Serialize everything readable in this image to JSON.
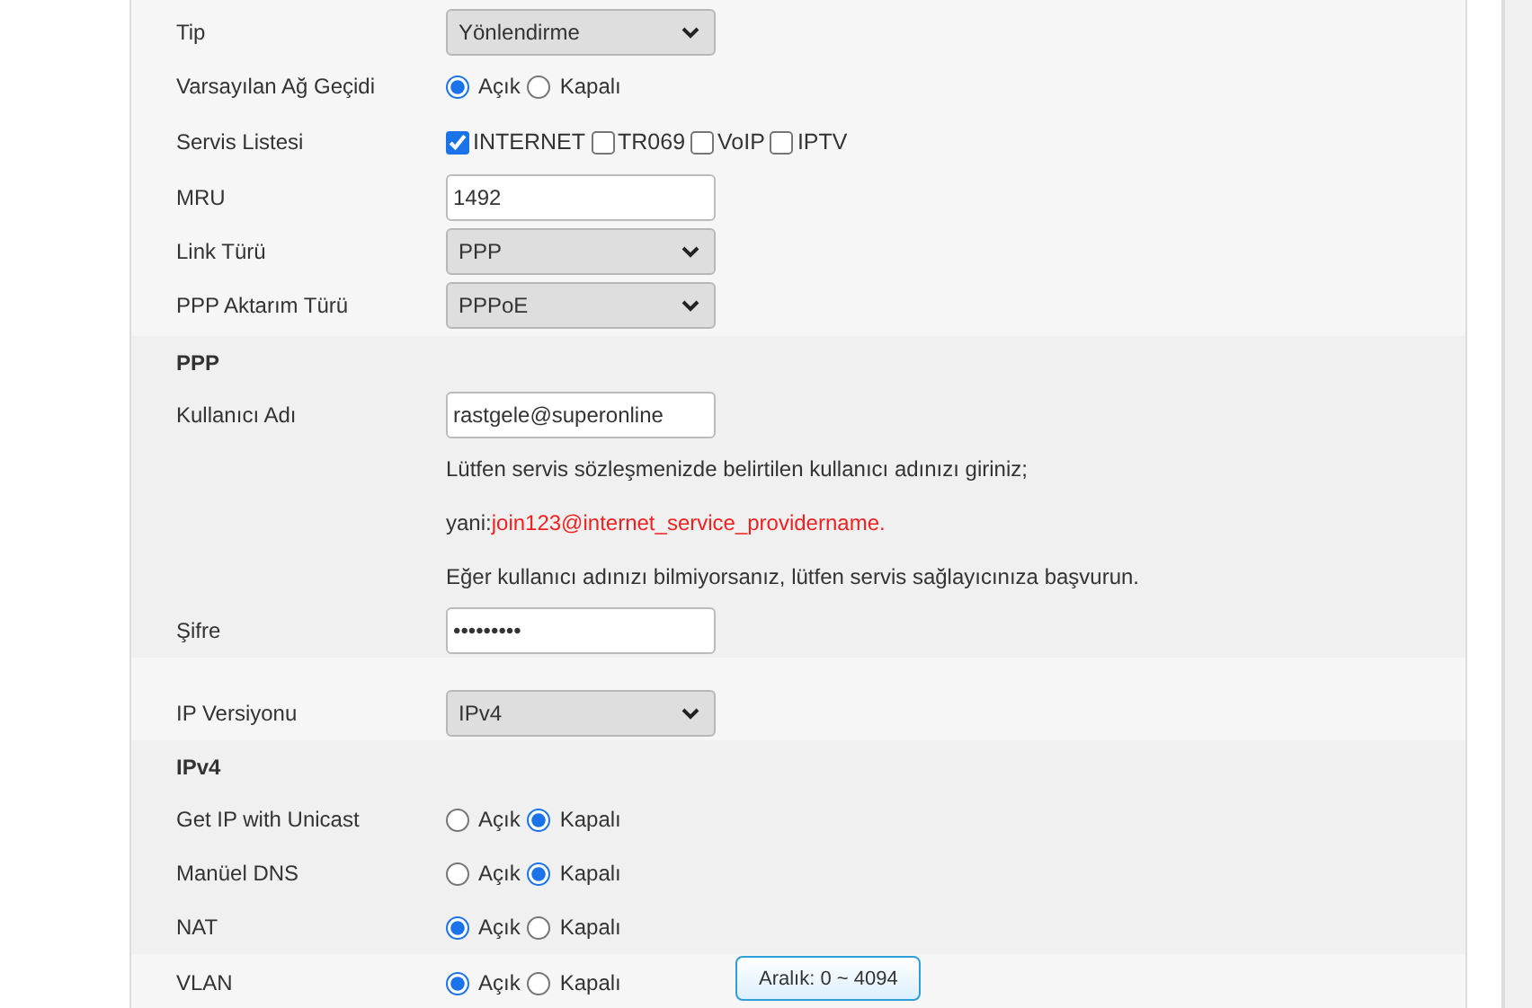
{
  "sections": [
    {
      "rows": [
        {
          "kind": "select",
          "label": "Tip",
          "value": "Yönlendirme"
        },
        {
          "kind": "radio",
          "label": "Varsayılan Ağ Geçidi",
          "options": [
            {
              "label": "Açık",
              "selected": true
            },
            {
              "label": "Kapalı",
              "selected": false
            }
          ]
        },
        {
          "kind": "checkboxes",
          "label": "Servis Listesi",
          "options": [
            {
              "label": "INTERNET",
              "checked": true
            },
            {
              "label": "TR069",
              "checked": false
            },
            {
              "label": "VoIP",
              "checked": false
            },
            {
              "label": "IPTV",
              "checked": false
            }
          ]
        },
        {
          "kind": "text",
          "label": "MRU",
          "value": "1492"
        },
        {
          "kind": "select",
          "label": "Link Türü",
          "value": "PPP"
        },
        {
          "kind": "select",
          "label": "PPP Aktarım Türü",
          "value": "PPPoE"
        }
      ]
    },
    {
      "heading": "PPP",
      "rows": [
        {
          "kind": "text",
          "label": "Kullanıcı Adı",
          "value": "rastgele@superonline"
        },
        {
          "kind": "note",
          "parts": [
            {
              "text": "Lütfen servis sözleşmenizde belirtilen kullanıcı adınızı giriniz;",
              "highlight": false
            }
          ]
        },
        {
          "kind": "note",
          "parts": [
            {
              "text": "yani:",
              "highlight": false
            },
            {
              "text": "join123@internet_service_providername.",
              "highlight": true
            }
          ]
        },
        {
          "kind": "note",
          "parts": [
            {
              "text": "Eğer kullanıcı adınızı bilmiyorsanız, lütfen servis sağlayıcınıza başvurun.",
              "highlight": false
            }
          ]
        },
        {
          "kind": "text",
          "label": "Şifre",
          "value": "•••••••••"
        }
      ]
    },
    {
      "rows": [
        {
          "kind": "select",
          "label": "IP Versiyonu",
          "value": "IPv4"
        }
      ]
    },
    {
      "heading": "IPv4",
      "rows": [
        {
          "kind": "radio",
          "label": "Get IP with Unicast",
          "options": [
            {
              "label": "Açık",
              "selected": false
            },
            {
              "label": "Kapalı",
              "selected": true
            }
          ]
        },
        {
          "kind": "radio",
          "label": "Manüel DNS",
          "options": [
            {
              "label": "Açık",
              "selected": false
            },
            {
              "label": "Kapalı",
              "selected": true
            }
          ]
        },
        {
          "kind": "radio",
          "label": "NAT",
          "options": [
            {
              "label": "Açık",
              "selected": true
            },
            {
              "label": "Kapalı",
              "selected": false
            }
          ]
        }
      ]
    },
    {
      "rows": [
        {
          "kind": "radio",
          "label": "VLAN",
          "options": [
            {
              "label": "Açık",
              "selected": true
            },
            {
              "label": "Kapalı",
              "selected": false
            }
          ]
        }
      ],
      "tooltip": "Aralık: 0 ~ 4094"
    }
  ]
}
